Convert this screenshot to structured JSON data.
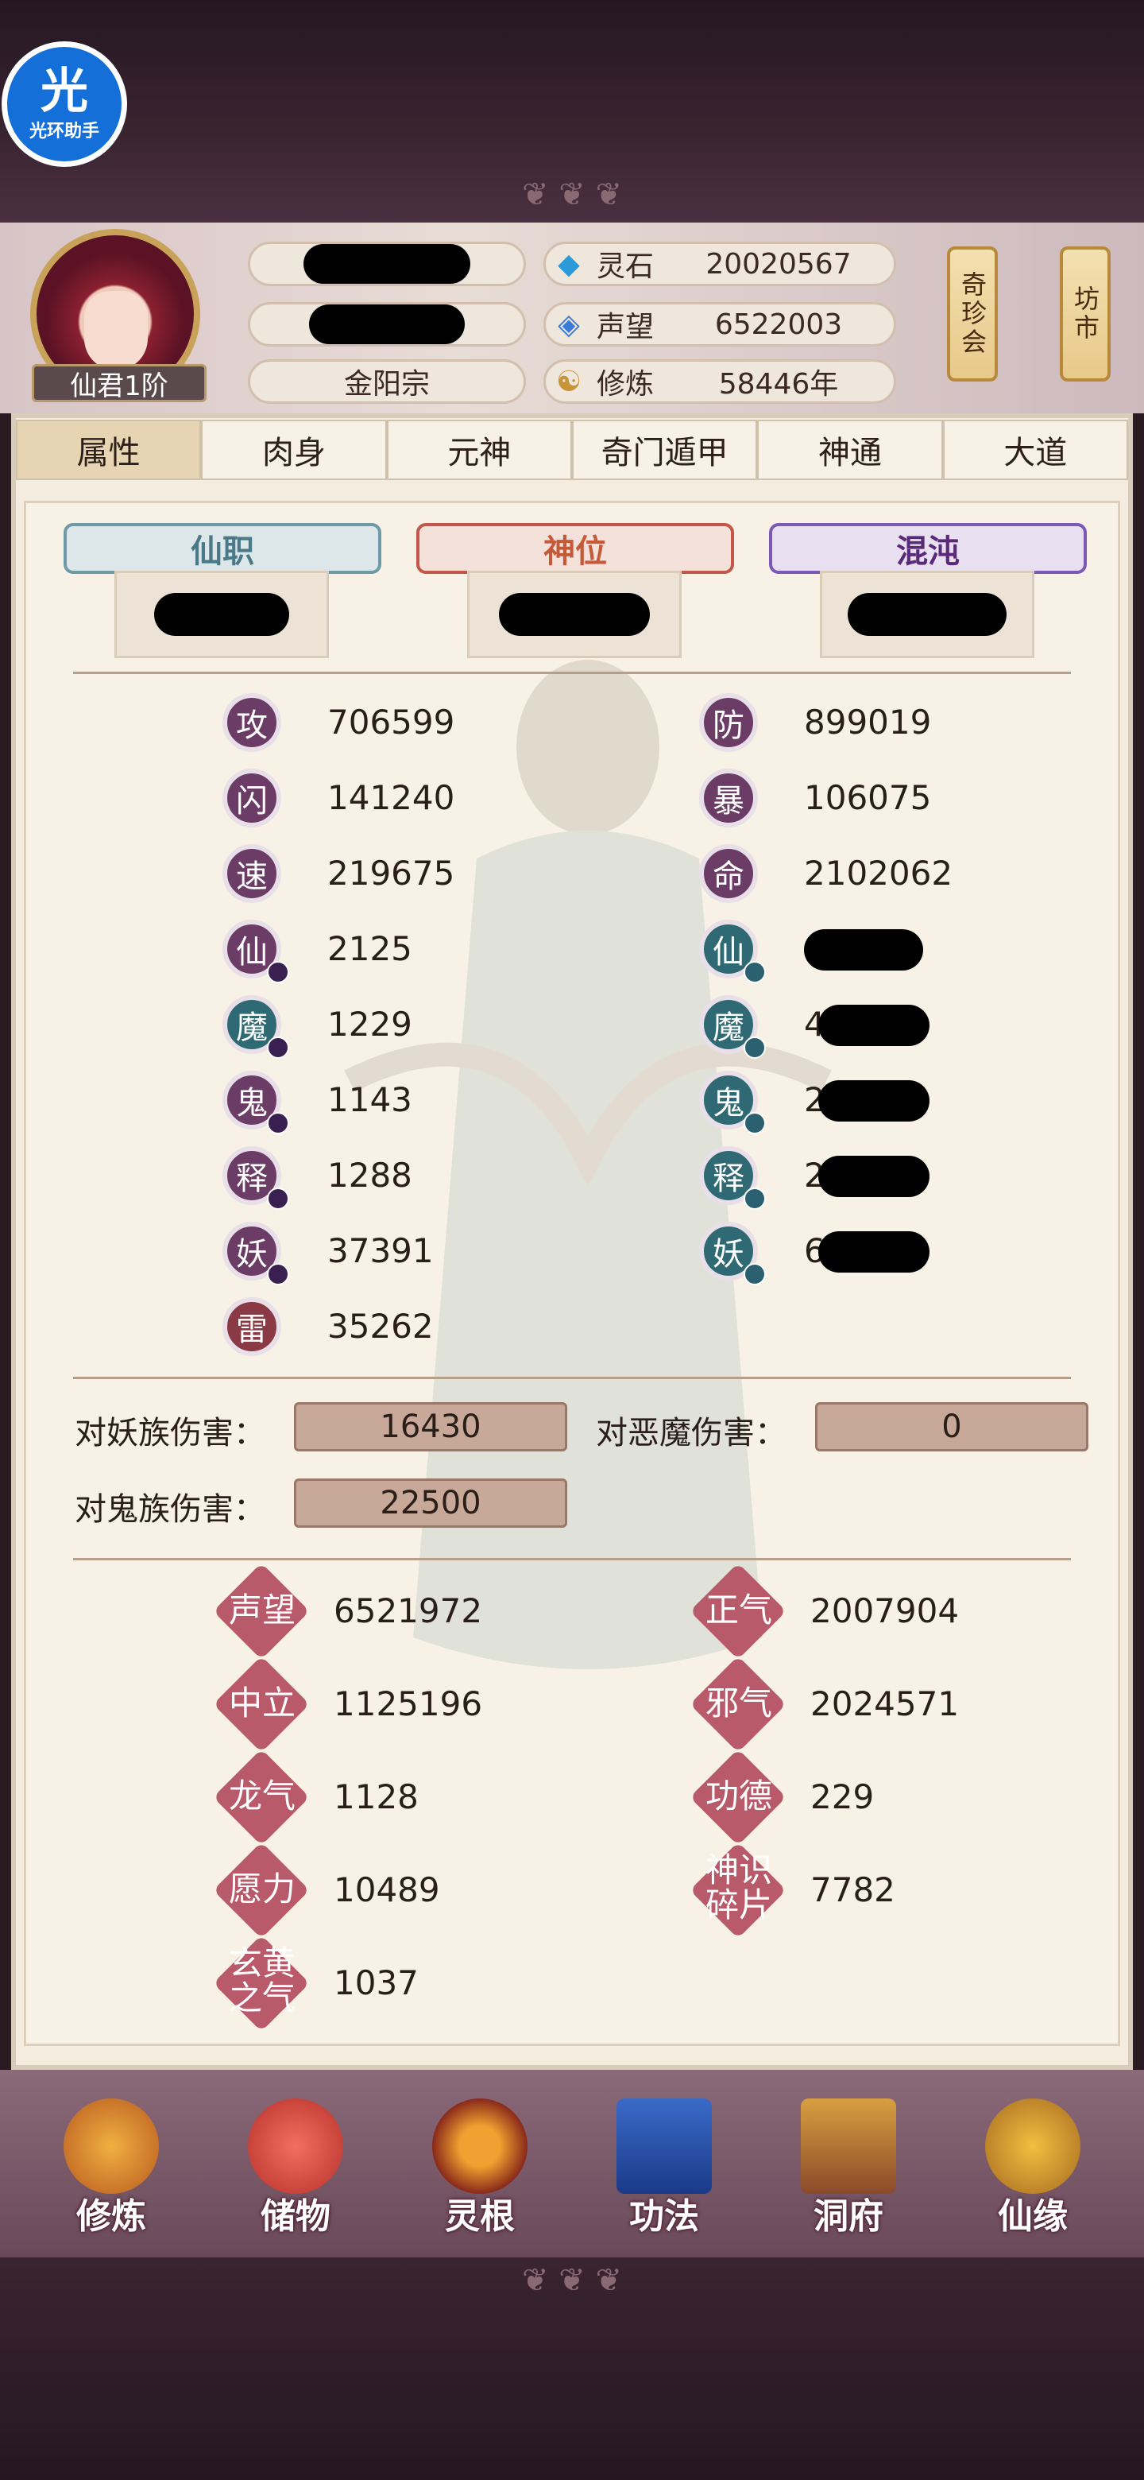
{
  "overlay": {
    "badge_big": "光",
    "badge_small": "光环助手"
  },
  "player": {
    "rank": "仙君1阶",
    "sect": "金阳宗"
  },
  "resources": [
    {
      "icon": "spirit-stone-icon",
      "glyph": "◆",
      "label": "灵石",
      "value": "20020567"
    },
    {
      "icon": "reputation-crystal-icon",
      "glyph": "◈",
      "label": "声望",
      "value": "6522003"
    },
    {
      "icon": "cultivation-icon",
      "glyph": "☯",
      "label": "修炼",
      "value": "58446年"
    }
  ],
  "shops": {
    "rare": "奇珍会",
    "market": "坊市"
  },
  "tabs": [
    "属性",
    "肉身",
    "元神",
    "奇门遁甲",
    "神通",
    "大道"
  ],
  "titles": {
    "xianzhi": "仙职",
    "shenwei": "神位",
    "hundun": "混沌"
  },
  "stats_left": [
    {
      "label": "攻",
      "value": "706599"
    },
    {
      "label": "闪",
      "value": "141240"
    },
    {
      "label": "速",
      "value": "219675"
    },
    {
      "label": "仙",
      "value": "2125"
    },
    {
      "label": "魔",
      "value": "1229"
    },
    {
      "label": "鬼",
      "value": "1143"
    },
    {
      "label": "释",
      "value": "1288"
    },
    {
      "label": "妖",
      "value": "37391"
    },
    {
      "label": "雷",
      "value": "35262"
    }
  ],
  "stats_right": [
    {
      "label": "防",
      "value": "899019"
    },
    {
      "label": "暴",
      "value": "106075"
    },
    {
      "label": "命",
      "value": "2102062"
    },
    {
      "label": "仙",
      "value": ""
    },
    {
      "label": "魔",
      "value": "4"
    },
    {
      "label": "鬼",
      "value": "2"
    },
    {
      "label": "释",
      "value": "2"
    },
    {
      "label": "妖",
      "value": "6"
    }
  ],
  "damage": {
    "vs_yao_label": "对妖族伤害：",
    "vs_yao_value": "16430",
    "vs_emo_label": "对恶魔伤害：",
    "vs_emo_value": "0",
    "vs_gui_label": "对鬼族伤害：",
    "vs_gui_value": "22500"
  },
  "reputation": [
    {
      "label": "声望",
      "value": "6521972"
    },
    {
      "label": "正气",
      "value": "2007904"
    },
    {
      "label": "中立",
      "value": "1125196"
    },
    {
      "label": "邪气",
      "value": "2024571"
    },
    {
      "label": "龙气",
      "value": "1128"
    },
    {
      "label": "功德",
      "value": "229"
    },
    {
      "label": "愿力",
      "value": "10489"
    },
    {
      "label": "神识碎片",
      "value": "7782"
    },
    {
      "label": "玄黄之气",
      "value": "1037"
    }
  ],
  "nav": [
    "修炼",
    "储物",
    "灵根",
    "功法",
    "洞府",
    "仙缘"
  ],
  "colors": {
    "panel_bg": "#f8f2e6",
    "tab_active": "#e6d4b2",
    "attr_icon": "#6a3c66",
    "resist_icon": "#2f6a74",
    "rep_icon": "#b85a6a"
  }
}
